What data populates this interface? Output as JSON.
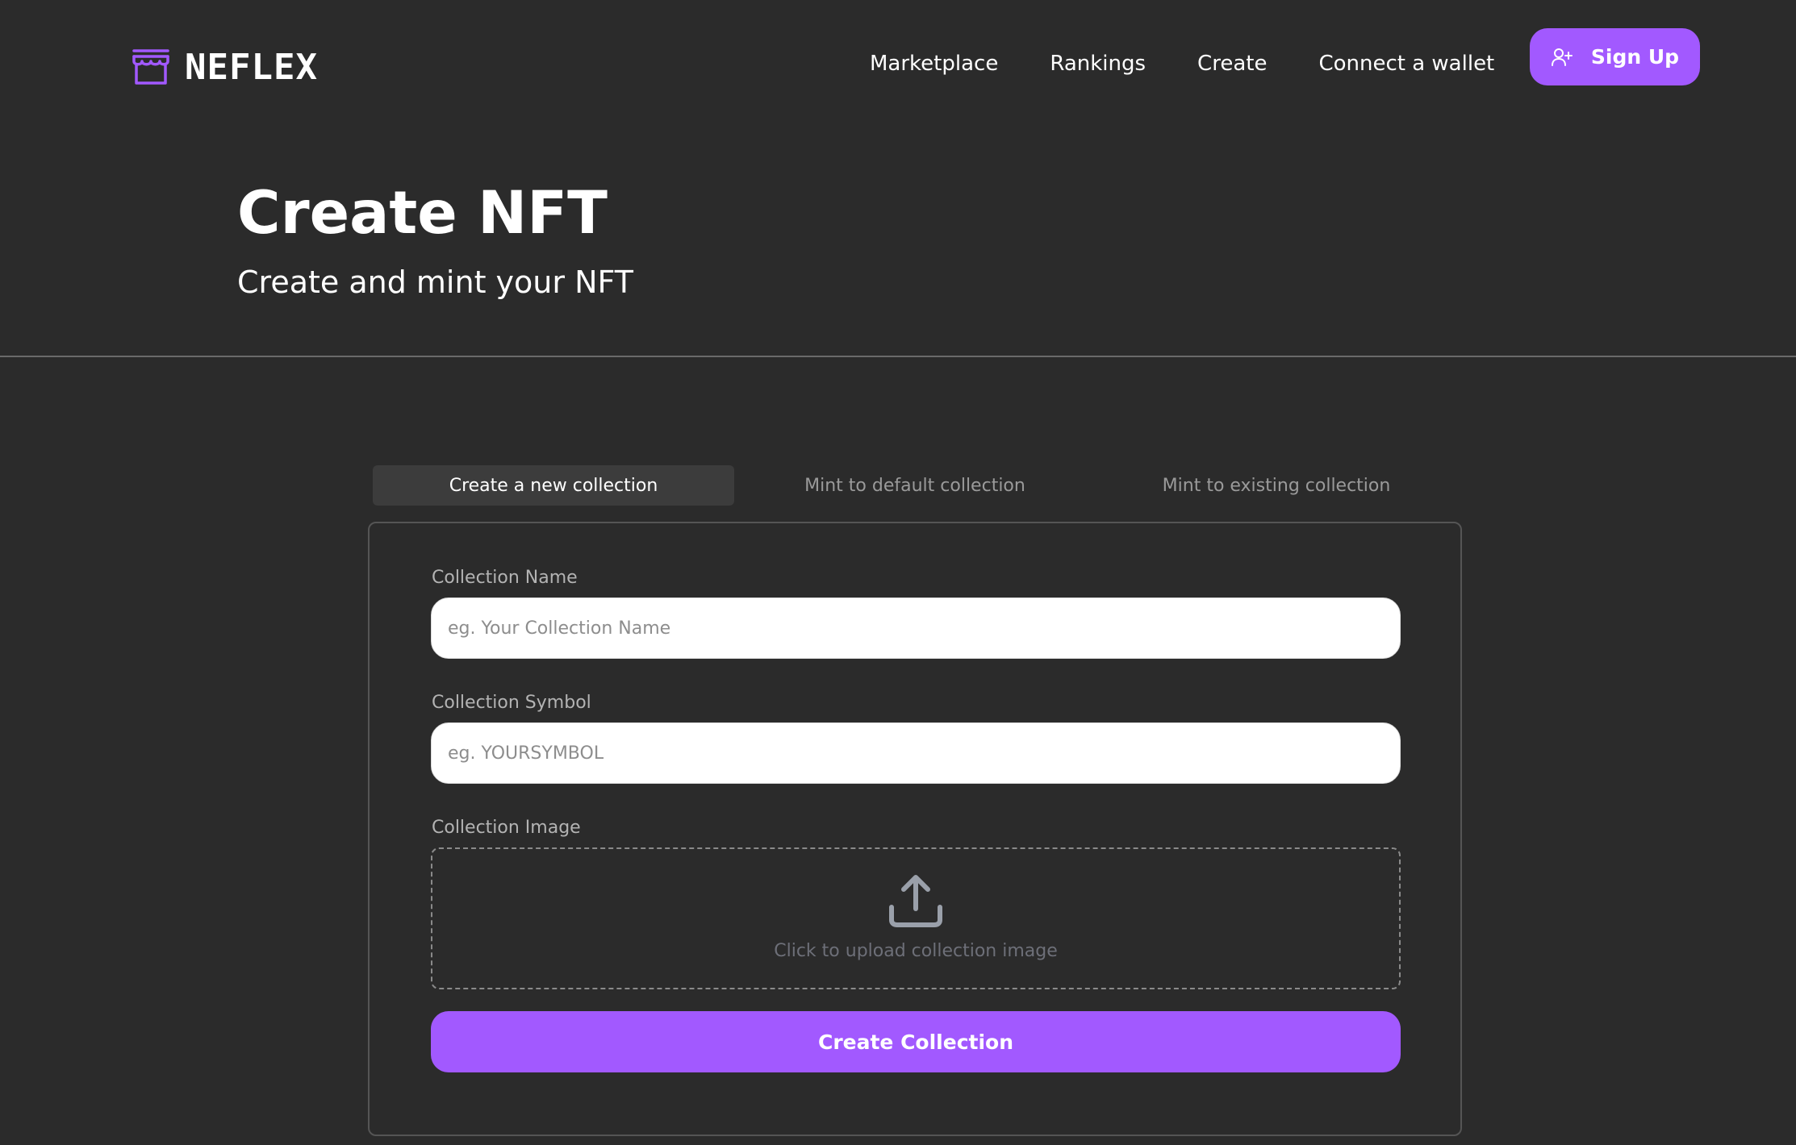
{
  "brand": {
    "name": "NEFLEX",
    "icon": "storefront-icon",
    "accent_color": "#a259ff"
  },
  "nav": {
    "links": [
      "Marketplace",
      "Rankings",
      "Create",
      "Connect a wallet"
    ],
    "signup_label": "Sign Up",
    "signup_icon": "user-plus-icon"
  },
  "hero": {
    "title": "Create NFT",
    "subtitle": "Create and mint your NFT"
  },
  "tabs": {
    "items": [
      "Create a new collection",
      "Mint to default collection",
      "Mint to existing collection"
    ],
    "active": "Create a new collection"
  },
  "form": {
    "name_label": "Collection Name",
    "name_placeholder": "eg. Your Collection Name",
    "symbol_label": "Collection Symbol",
    "symbol_placeholder": "eg. YOURSYMBOL",
    "image_label": "Collection Image",
    "upload_icon": "upload-icon",
    "upload_text": "Click to upload collection image",
    "submit_label": "Create Collection"
  },
  "colors": {
    "background": "#2b2b2b",
    "accent": "#a259ff",
    "tab_active_bg": "#3c3c3c",
    "muted_text": "#9a9a9a"
  }
}
